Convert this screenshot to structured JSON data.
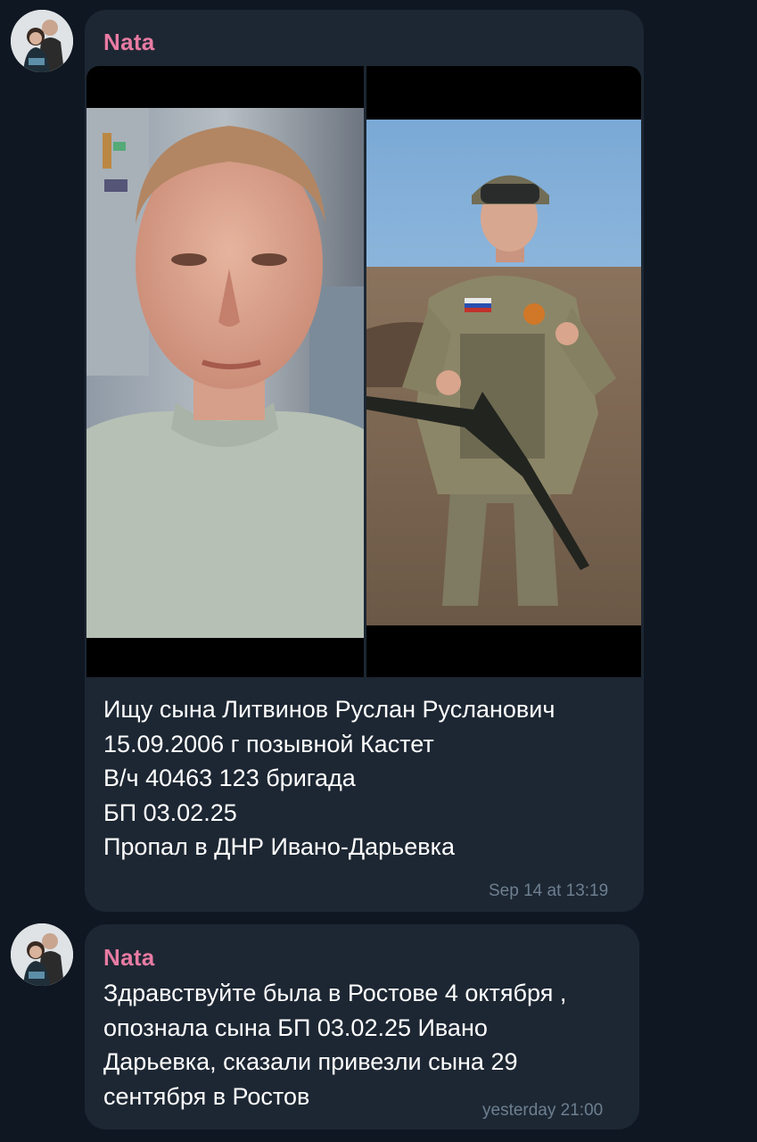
{
  "messages": [
    {
      "sender": "Nata",
      "text": "Ищу сына Литвинов Руслан Русланович\n15.09.2006 г позывной Кастет\nВ/ч 40463 123 бригада\nБП 03.02.25\nПропал в ДНР Ивано-Дарьевка",
      "time": "Sep 14 at 13:19",
      "photos": [
        "portrait-photo",
        "soldier-photo"
      ]
    },
    {
      "sender": "Nata",
      "text": "Здравствуйте была в Ростове 4 октября ,\nопознала сына БП 03.02.25 Ивано\nДарьевка, сказали привезли сына 29\nсентября в Ростов",
      "time": "yesterday 21:00"
    }
  ],
  "colors": {
    "background": "#0f1722",
    "bubble": "#1d2733",
    "sender_name": "#e87ba3",
    "message_text": "#ffffff",
    "timestamp": "#6d7f90"
  }
}
